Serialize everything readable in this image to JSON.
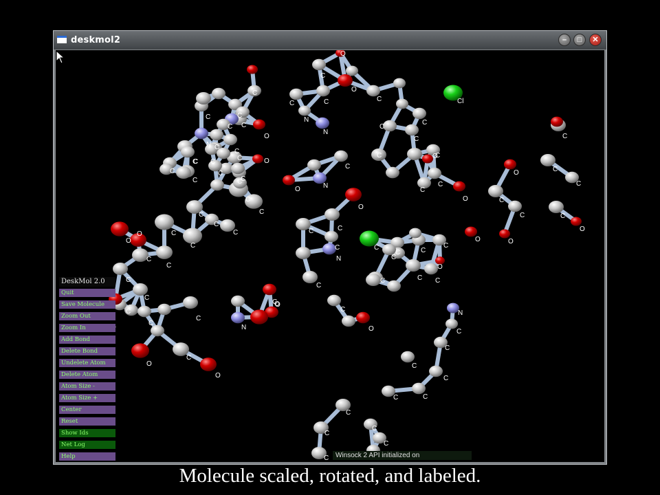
{
  "window": {
    "title": "deskmol2"
  },
  "menu": {
    "title": "DeskMol 2.0",
    "items": [
      {
        "label": "Quit",
        "style": "purple"
      },
      {
        "label": "Save Molecule",
        "style": "purple"
      },
      {
        "label": "Zoom Out",
        "style": "purple"
      },
      {
        "label": "Zoom In",
        "style": "purple"
      },
      {
        "label": "Add Bond",
        "style": "purple"
      },
      {
        "label": "Delete Bond",
        "style": "purple"
      },
      {
        "label": "Undelete Atom",
        "style": "purple"
      },
      {
        "label": "Delete Atom",
        "style": "purple"
      },
      {
        "label": "Atom Size -",
        "style": "purple"
      },
      {
        "label": "Atom Size +",
        "style": "purple"
      },
      {
        "label": "Center",
        "style": "purple"
      },
      {
        "label": "Reset",
        "style": "purple"
      },
      {
        "label": "Show Ids",
        "style": "green"
      },
      {
        "label": "Net Log",
        "style": "green"
      },
      {
        "label": "Help",
        "style": "purple"
      }
    ]
  },
  "status": "Winsock 2 API initialized on",
  "caption": "Molecule scaled, rotated, and labeled.",
  "colors": {
    "carbon": "#c8c8c8",
    "oxygen": "#d40000",
    "nitrogen": "#8c8ce0",
    "chlorine": "#18d018",
    "bond": "#a8bcd6",
    "label": "#ffffff",
    "menu_item_bg": "#6a4d8a",
    "menu_item_text": "#8dff6d"
  },
  "molecule": {
    "atom_labels": {
      "C": "C",
      "O": "O",
      "N": "N",
      "Cl": "Cl"
    }
  }
}
